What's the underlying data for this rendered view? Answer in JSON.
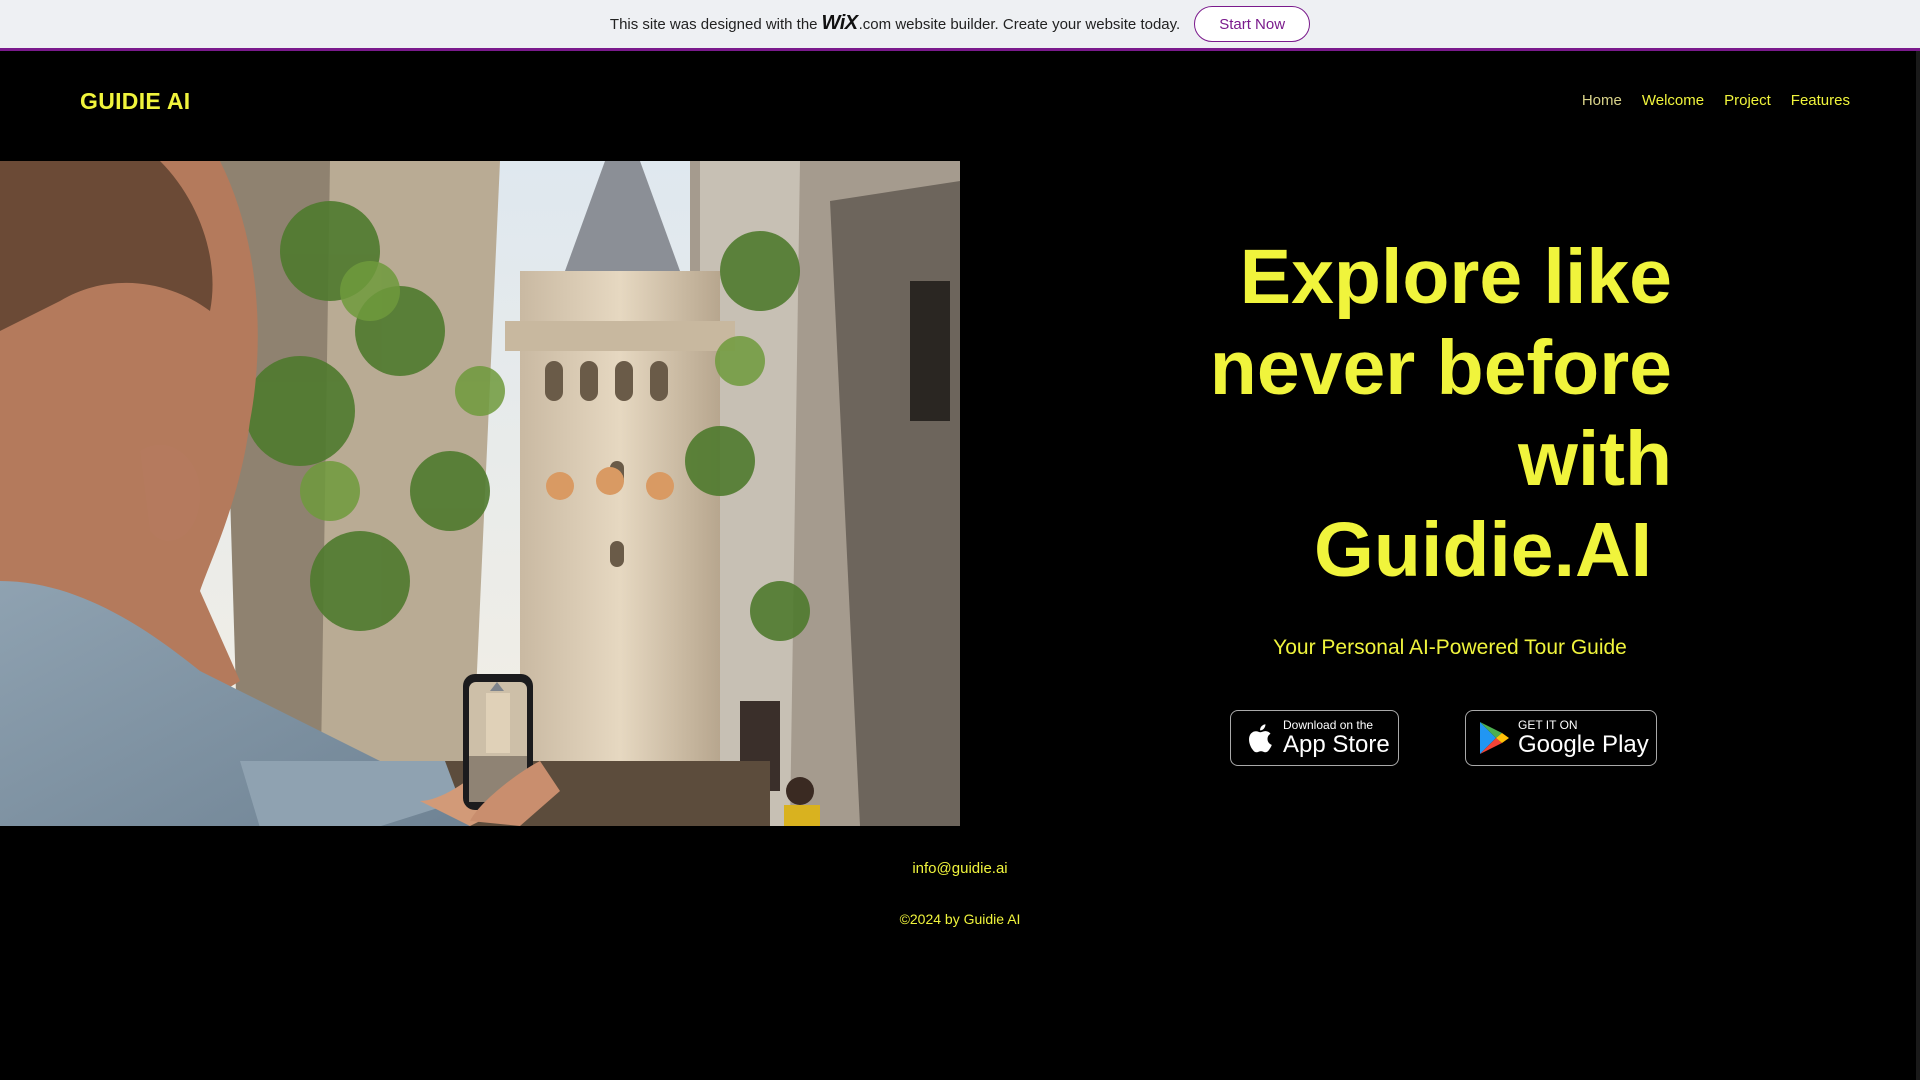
{
  "wix_banner": {
    "text_before": "This site was designed with the",
    "logo": "WiX",
    "text_after": ".com website builder. Create your website today.",
    "cta": "Start Now"
  },
  "header": {
    "logo": "GUIDIE AI",
    "nav": [
      "Home",
      "Welcome",
      "Project",
      "Features"
    ]
  },
  "hero": {
    "image_alt": "Traveler photographing Galata Tower with smartphone",
    "headline": [
      "Explore like",
      "never before",
      "with",
      "Guidie.AI"
    ],
    "tagline": "Your Personal AI-Powered Tour Guide",
    "app_store": {
      "small": "Download on the",
      "big": "App Store"
    },
    "google_play": {
      "small": "GET IT ON",
      "big": "Google Play"
    }
  },
  "footer": {
    "email": "info@guidie.ai",
    "copyright": "©2024 by Guidie AI"
  },
  "colors": {
    "accent": "#f0f43c",
    "background": "#000000",
    "wix_purple": "#7a1a8c"
  }
}
